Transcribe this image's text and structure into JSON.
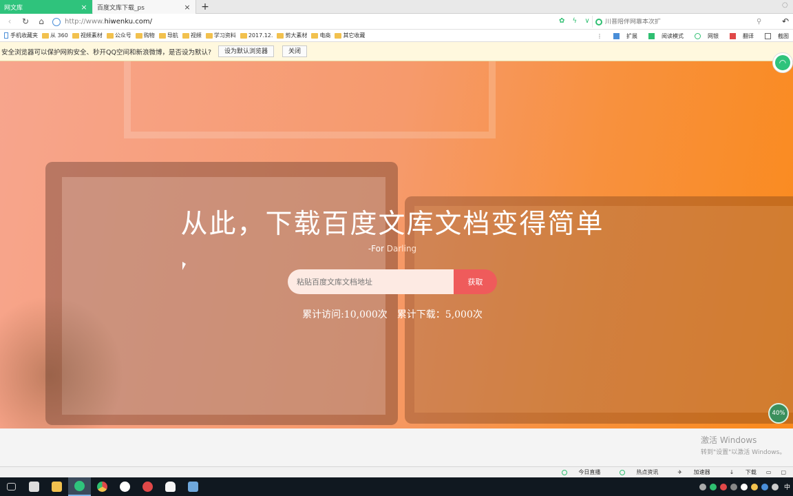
{
  "tabs": [
    {
      "title": "网文库",
      "active": true,
      "close": "×"
    },
    {
      "title": "百度文库下载_ps",
      "active": false,
      "close": "×"
    }
  ],
  "newtab": "+",
  "addressbar": {
    "url_prefix": "http://www.",
    "url_domain": "hiwenku.com/",
    "search_placeholder": "川普陪伴网靠本次扩",
    "back": "‹",
    "reload": "↻",
    "home": "⌂",
    "undo": "↶"
  },
  "bookmarks": {
    "items": [
      "手机收藏夹",
      "从 360",
      "视频素材",
      "公众号",
      "购物",
      "导航",
      "视频",
      "学习资料",
      "2017.12.",
      "剪大素材",
      "电商",
      "其它收藏"
    ],
    "right": [
      "扩展",
      "阅读模式",
      "网银",
      "翻译",
      "截图"
    ]
  },
  "notify": {
    "message": "安全浏览器可以保护网购安全、秒开QQ空间和新浪微博，是否设为默认?",
    "set_default_label": "设为默认浏览器",
    "close_label": "关闭"
  },
  "hero": {
    "headline": "从此，下载百度文库文档变得简单",
    "sub_prefix": "-For",
    "sub_name": "Darling",
    "input_placeholder": "粘贴百度文库文档地址",
    "button_label": "获取",
    "stat_visits": "累计访问:10,000次",
    "stat_downloads": "累计下载：5,000次"
  },
  "progress_badge": "40%",
  "watermark": {
    "line1": "激活 Windows",
    "line2": "转到\"设置\"以激活 Windows。"
  },
  "statusbar": [
    "今日直播",
    "热点资讯",
    "加速器",
    "下载"
  ],
  "taskbar": {
    "apps": [
      "task-view",
      "start-tile",
      "file-explorer",
      "360-browser",
      "chrome",
      "wechat",
      "netease-music",
      "qq",
      "notepad"
    ],
    "ime": "中"
  },
  "colors": {
    "accent_green": "#2fc37c",
    "hero_left": "#f7a58d",
    "hero_right": "#fa8a1c",
    "button_red": "#ef5b5b"
  }
}
